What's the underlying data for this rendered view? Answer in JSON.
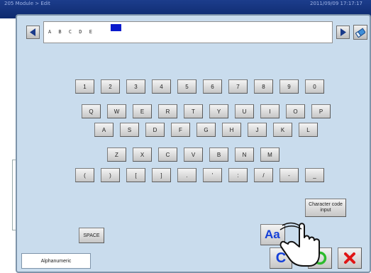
{
  "window": {
    "title_left": "205 Module > Edit",
    "title_right": "2011/09/09 17:17:17"
  },
  "input": {
    "value": "A B C D E"
  },
  "keyboard": {
    "rows": [
      [
        "1",
        "2",
        "3",
        "4",
        "5",
        "6",
        "7",
        "8",
        "9",
        "0"
      ],
      [
        "Q",
        "W",
        "E",
        "R",
        "T",
        "Y",
        "U",
        "I",
        "O",
        "P"
      ],
      [
        "A",
        "S",
        "D",
        "F",
        "G",
        "H",
        "J",
        "K",
        "L"
      ],
      [
        "Z",
        "X",
        "C",
        "V",
        "B",
        "N",
        "M"
      ],
      [
        "(",
        ")",
        "[",
        "]",
        ".",
        "'",
        ":",
        "/",
        "-",
        "_"
      ]
    ]
  },
  "buttons": {
    "character_code_input": "Character code input",
    "space": "SPACE",
    "case_toggle": "Aa",
    "clear": "C"
  },
  "mode": {
    "label": "Alphanumeric"
  },
  "colors": {
    "panel_bg": "#c9dced",
    "titlebar": "#0e2a6e",
    "cursor": "#0a1acc",
    "clear_blue": "#1540d8",
    "ok_green": "#2dbb2d",
    "cancel_red": "#e01515"
  }
}
